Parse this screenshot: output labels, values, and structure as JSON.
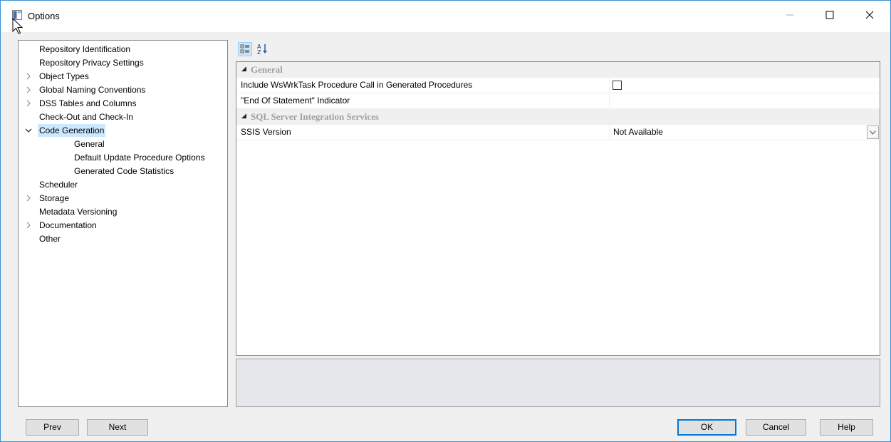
{
  "window": {
    "title": "Options",
    "accent_color": "#0078d7"
  },
  "tree": {
    "items": [
      {
        "label": "Repository Identification",
        "level": 0,
        "expander": "",
        "selected": false
      },
      {
        "label": "Repository Privacy Settings",
        "level": 0,
        "expander": "",
        "selected": false
      },
      {
        "label": "Object Types",
        "level": 0,
        "expander": "collapsed",
        "selected": false
      },
      {
        "label": "Global Naming Conventions",
        "level": 0,
        "expander": "collapsed",
        "selected": false
      },
      {
        "label": "DSS Tables and Columns",
        "level": 0,
        "expander": "collapsed",
        "selected": false
      },
      {
        "label": "Check-Out and Check-In",
        "level": 0,
        "expander": "",
        "selected": false
      },
      {
        "label": "Code Generation",
        "level": 0,
        "expander": "expanded",
        "selected": true
      },
      {
        "label": "General",
        "level": 1,
        "expander": "",
        "selected": false
      },
      {
        "label": "Default Update Procedure Options",
        "level": 1,
        "expander": "",
        "selected": false
      },
      {
        "label": "Generated Code Statistics",
        "level": 1,
        "expander": "",
        "selected": false
      },
      {
        "label": "Scheduler",
        "level": 0,
        "expander": "",
        "selected": false
      },
      {
        "label": "Storage",
        "level": 0,
        "expander": "collapsed",
        "selected": false
      },
      {
        "label": "Metadata Versioning",
        "level": 0,
        "expander": "",
        "selected": false
      },
      {
        "label": "Documentation",
        "level": 0,
        "expander": "collapsed",
        "selected": false
      },
      {
        "label": "Other",
        "level": 0,
        "expander": "",
        "selected": false
      }
    ]
  },
  "toolbar": {
    "categorized_icon": "categorized-view-icon",
    "alphabetical_icon": "alphabetical-sort-icon"
  },
  "grid": {
    "categories": [
      {
        "label": "General",
        "properties": [
          {
            "name": "Include WsWrkTask Procedure Call in Generated Procedures",
            "type": "checkbox",
            "checked": false,
            "value": ""
          },
          {
            "name": "\"End Of Statement\" Indicator",
            "type": "text",
            "value": ""
          }
        ]
      },
      {
        "label": "SQL Server Integration Services",
        "properties": [
          {
            "name": "SSIS Version",
            "type": "dropdown",
            "value": "Not Available"
          }
        ]
      }
    ]
  },
  "buttons": {
    "prev": "Prev",
    "next": "Next",
    "ok": "OK",
    "cancel": "Cancel",
    "help": "Help"
  }
}
